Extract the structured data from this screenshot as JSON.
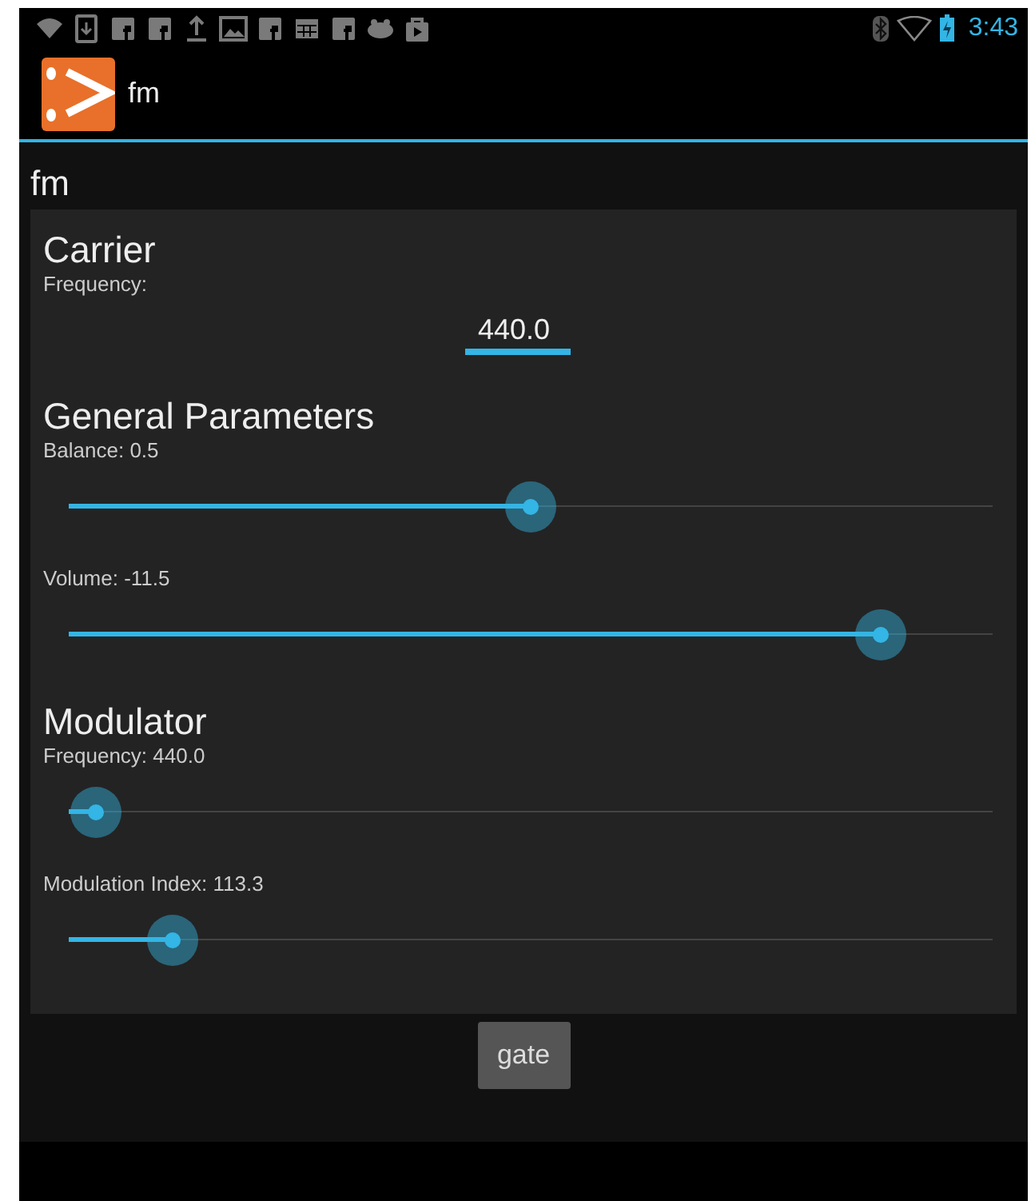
{
  "status_bar": {
    "time": "3:43"
  },
  "action_bar": {
    "title": "fm"
  },
  "page_title": "fm",
  "sections": [
    {
      "heading": "Carrier",
      "controls": [
        {
          "kind": "number",
          "label": "Frequency:",
          "value": "440.0"
        }
      ]
    },
    {
      "heading": "General Parameters",
      "controls": [
        {
          "kind": "slider",
          "label": "Balance: 0.5",
          "level": 0.5
        },
        {
          "kind": "slider",
          "label": "Volume: -11.5",
          "level": 0.879
        }
      ]
    },
    {
      "heading": "Modulator",
      "controls": [
        {
          "kind": "slider",
          "label": "Frequency: 440.0",
          "level": 0.03
        },
        {
          "kind": "slider",
          "label": "Modulation Index: 113.3",
          "level": 0.113
        }
      ]
    }
  ],
  "buttons": [
    {
      "label": "gate"
    }
  ]
}
